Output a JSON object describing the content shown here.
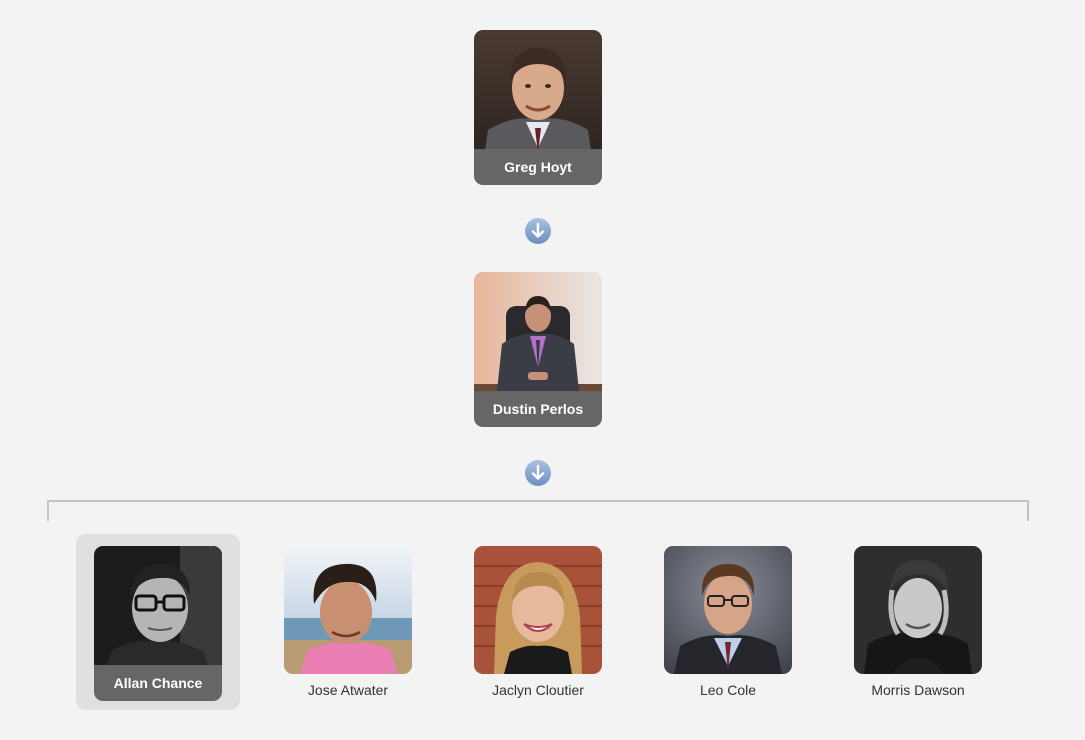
{
  "chain": [
    {
      "name": "Greg Hoyt"
    },
    {
      "name": "Dustin Perlos"
    }
  ],
  "children": [
    {
      "name": "Allan Chance",
      "selected": true
    },
    {
      "name": "Jose Atwater",
      "selected": false
    },
    {
      "name": "Jaclyn Cloutier",
      "selected": false
    },
    {
      "name": "Leo Cole",
      "selected": false
    },
    {
      "name": "Morris Dawson",
      "selected": false
    }
  ],
  "icons": {
    "expand": "arrow-down-circle-icon"
  },
  "colors": {
    "background": "#f3f3f3",
    "nameplate": "#666666",
    "selected_highlight": "#e0e0e0",
    "connector": "#c4c4c4",
    "arrow_button": "#8ea9d0"
  }
}
